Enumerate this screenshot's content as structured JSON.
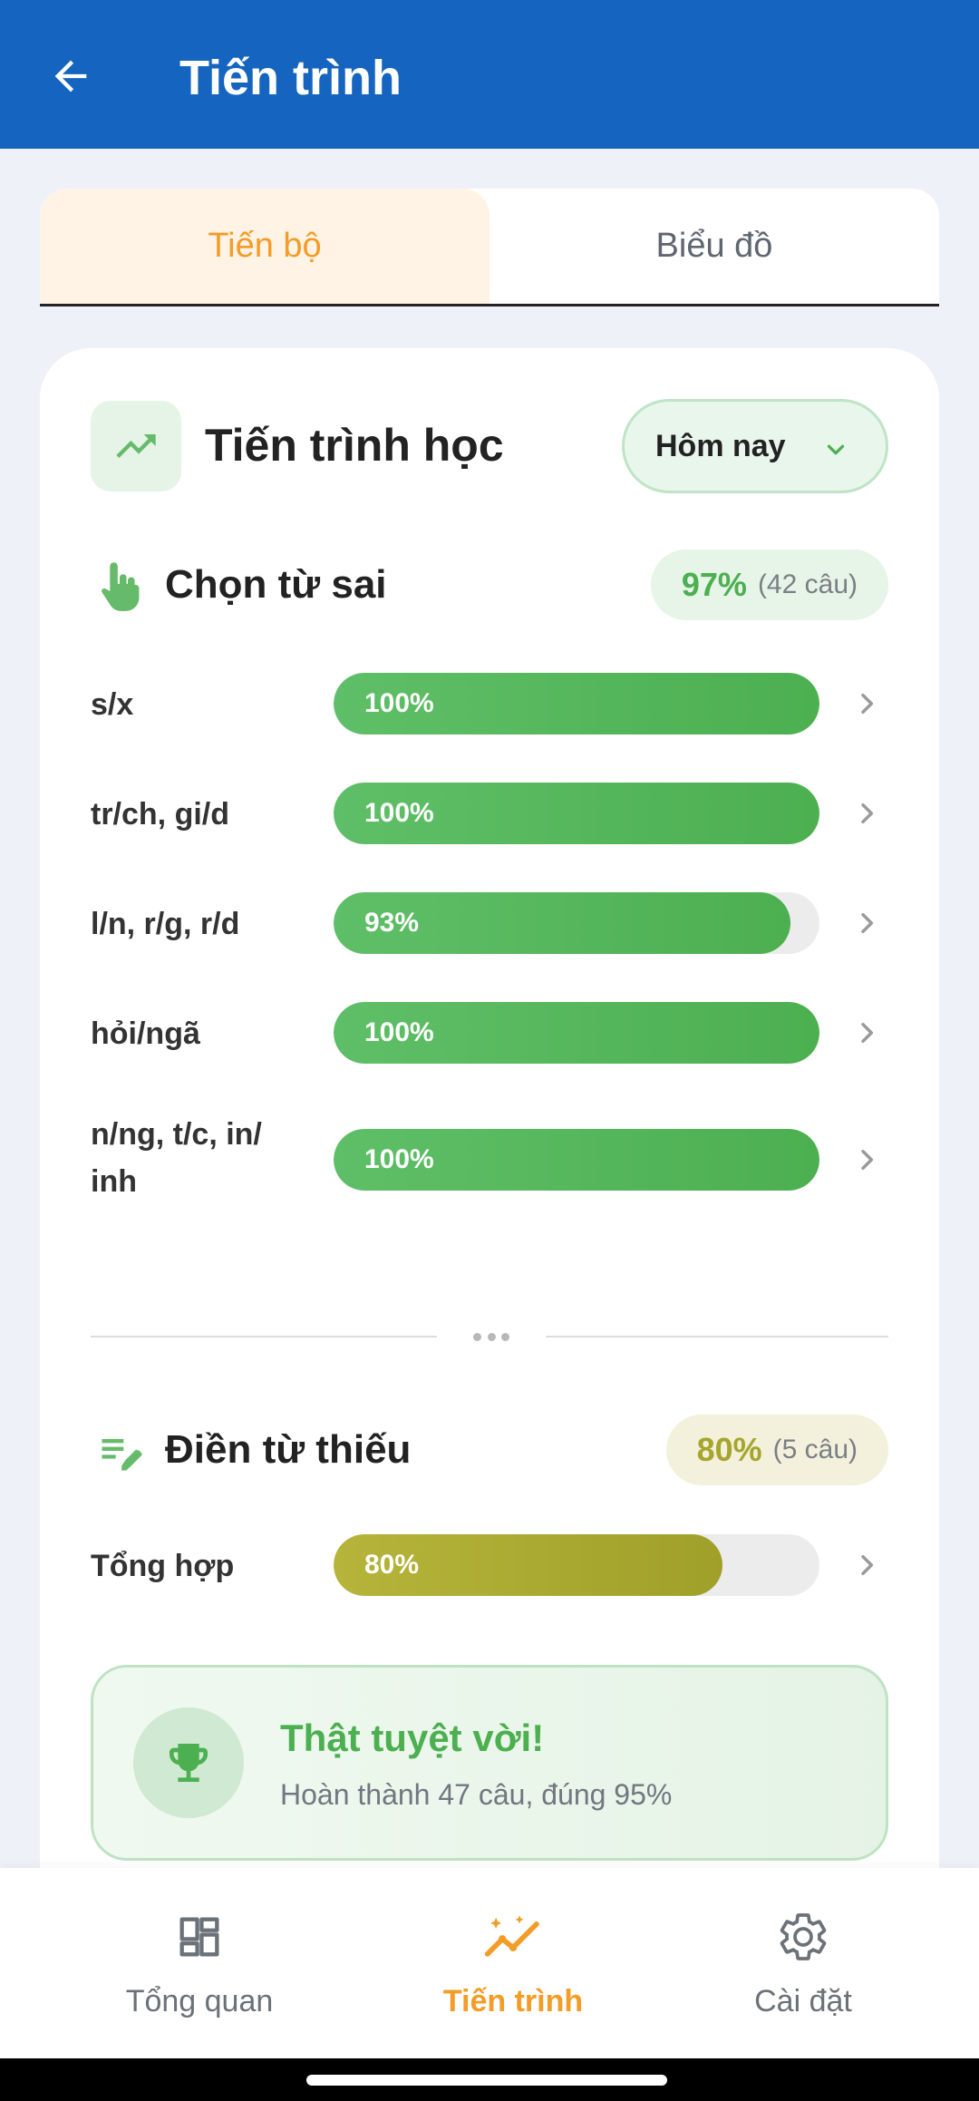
{
  "app_bar": {
    "title": "Tiến trình",
    "back_icon": "arrow-left-icon"
  },
  "tabs": [
    {
      "label": "Tiến bộ",
      "active": true
    },
    {
      "label": "Biểu đồ",
      "active": false
    }
  ],
  "progress_card": {
    "title": "Tiến trình học",
    "icon": "trending-up-icon",
    "period": {
      "selected": "Hôm nay",
      "icon": "chevron-down-icon"
    }
  },
  "section_choose": {
    "name": "Chọn từ sai",
    "icon": "touch-hand-icon",
    "percent": "97%",
    "count": "(42 câu)",
    "rows": [
      {
        "label": "s/x",
        "value": 100,
        "text": "100%"
      },
      {
        "label": "tr/ch, gi/d",
        "value": 100,
        "text": "100%"
      },
      {
        "label": "l/n, r/g, r/d",
        "value": 93,
        "text": "93%"
      },
      {
        "label": "hỏi/ngã",
        "value": 100,
        "text": "100%"
      },
      {
        "label": "n/ng, t/c, in/ inh",
        "value": 100,
        "text": "100%"
      }
    ]
  },
  "section_fill": {
    "name": "Điền từ thiếu",
    "icon": "edit-note-icon",
    "percent": "80%",
    "count": "(5 câu)",
    "rows": [
      {
        "label": "Tổng hợp",
        "value": 80,
        "text": "80%"
      }
    ]
  },
  "banner": {
    "title": "Thật tuyệt vời!",
    "subtitle": "Hoàn thành 47 câu, đúng 95%",
    "icon": "trophy-icon"
  },
  "bottom_nav": [
    {
      "label": "Tổng quan",
      "icon": "dashboard-icon",
      "active": false
    },
    {
      "label": "Tiến trình",
      "icon": "progress-chart-icon",
      "active": true
    },
    {
      "label": "Cài đặt",
      "icon": "gear-icon",
      "active": false
    }
  ],
  "colors": {
    "primary": "#1565c0",
    "accent": "#f39c26",
    "success": "#4caf50",
    "olive": "#a6a52e"
  }
}
